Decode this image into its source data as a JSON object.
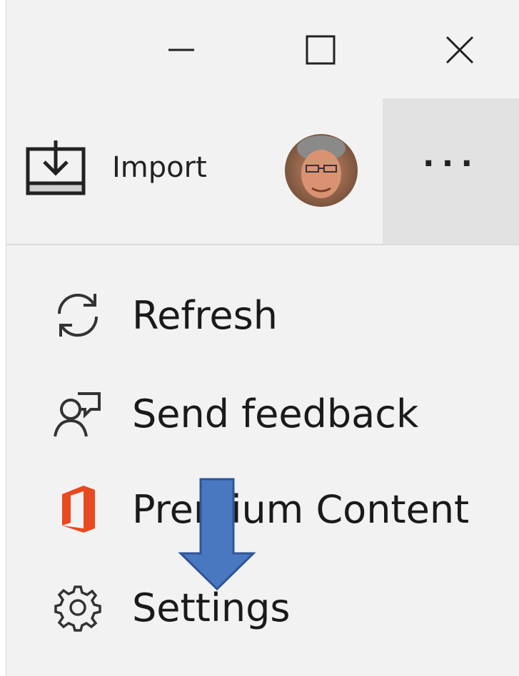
{
  "toolbar": {
    "import_label": "Import",
    "more_label": "···"
  },
  "menu": {
    "items": [
      {
        "label": "Refresh",
        "icon": "refresh-icon"
      },
      {
        "label": "Send feedback",
        "icon": "feedback-icon"
      },
      {
        "label": "Premium Content",
        "icon": "office-icon"
      },
      {
        "label": "Settings",
        "icon": "gear-icon"
      }
    ]
  },
  "colors": {
    "office_orange": "#e8491f",
    "annotation_arrow": "#4a78c0",
    "more_button_bg": "#e2e2e2",
    "window_bg": "#f2f2f2"
  }
}
